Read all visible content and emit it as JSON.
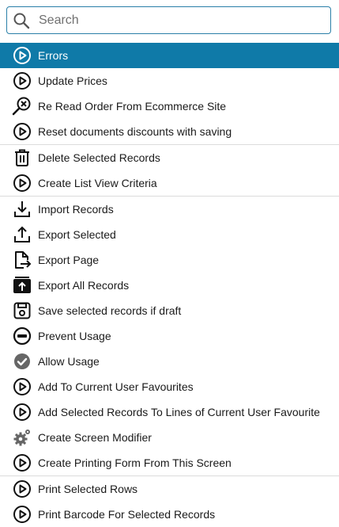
{
  "search": {
    "placeholder": "Search",
    "value": ""
  },
  "menu": {
    "items": [
      {
        "label": "Errors",
        "icon": "play-circle-icon",
        "active": true
      },
      {
        "label": "Update Prices",
        "icon": "play-circle-icon"
      },
      {
        "label": "Re Read Order From Ecommerce Site",
        "icon": "search-x-icon"
      },
      {
        "label": "Reset documents discounts with saving",
        "icon": "play-circle-icon"
      },
      {
        "label": "Delete Selected Records",
        "icon": "trash-icon"
      },
      {
        "label": "Create List View Criteria",
        "icon": "play-circle-icon"
      },
      {
        "label": "Import Records",
        "icon": "download-icon"
      },
      {
        "label": "Export Selected",
        "icon": "upload-icon"
      },
      {
        "label": "Export Page",
        "icon": "file-export-icon"
      },
      {
        "label": "Export All Records",
        "icon": "upload-box-icon"
      },
      {
        "label": "Save selected records if draft",
        "icon": "save-icon"
      },
      {
        "label": "Prevent Usage",
        "icon": "minus-circle-icon"
      },
      {
        "label": "Allow Usage",
        "icon": "check-circle-icon"
      },
      {
        "label": "Add To Current User Favourites",
        "icon": "play-circle-icon"
      },
      {
        "label": "Add Selected Records To Lines of Current User Favourite",
        "icon": "play-circle-icon"
      },
      {
        "label": "Create Screen Modifier",
        "icon": "gear-icon"
      },
      {
        "label": "Create Printing Form From This Screen",
        "icon": "play-circle-icon"
      },
      {
        "label": "Print Selected Rows",
        "icon": "play-circle-icon"
      },
      {
        "label": "Print Barcode For Selected Records",
        "icon": "play-circle-icon"
      }
    ]
  },
  "colors": {
    "accent": "#0f7aa8",
    "border": "#2a7fa8",
    "divider": "#dcdcdc"
  }
}
